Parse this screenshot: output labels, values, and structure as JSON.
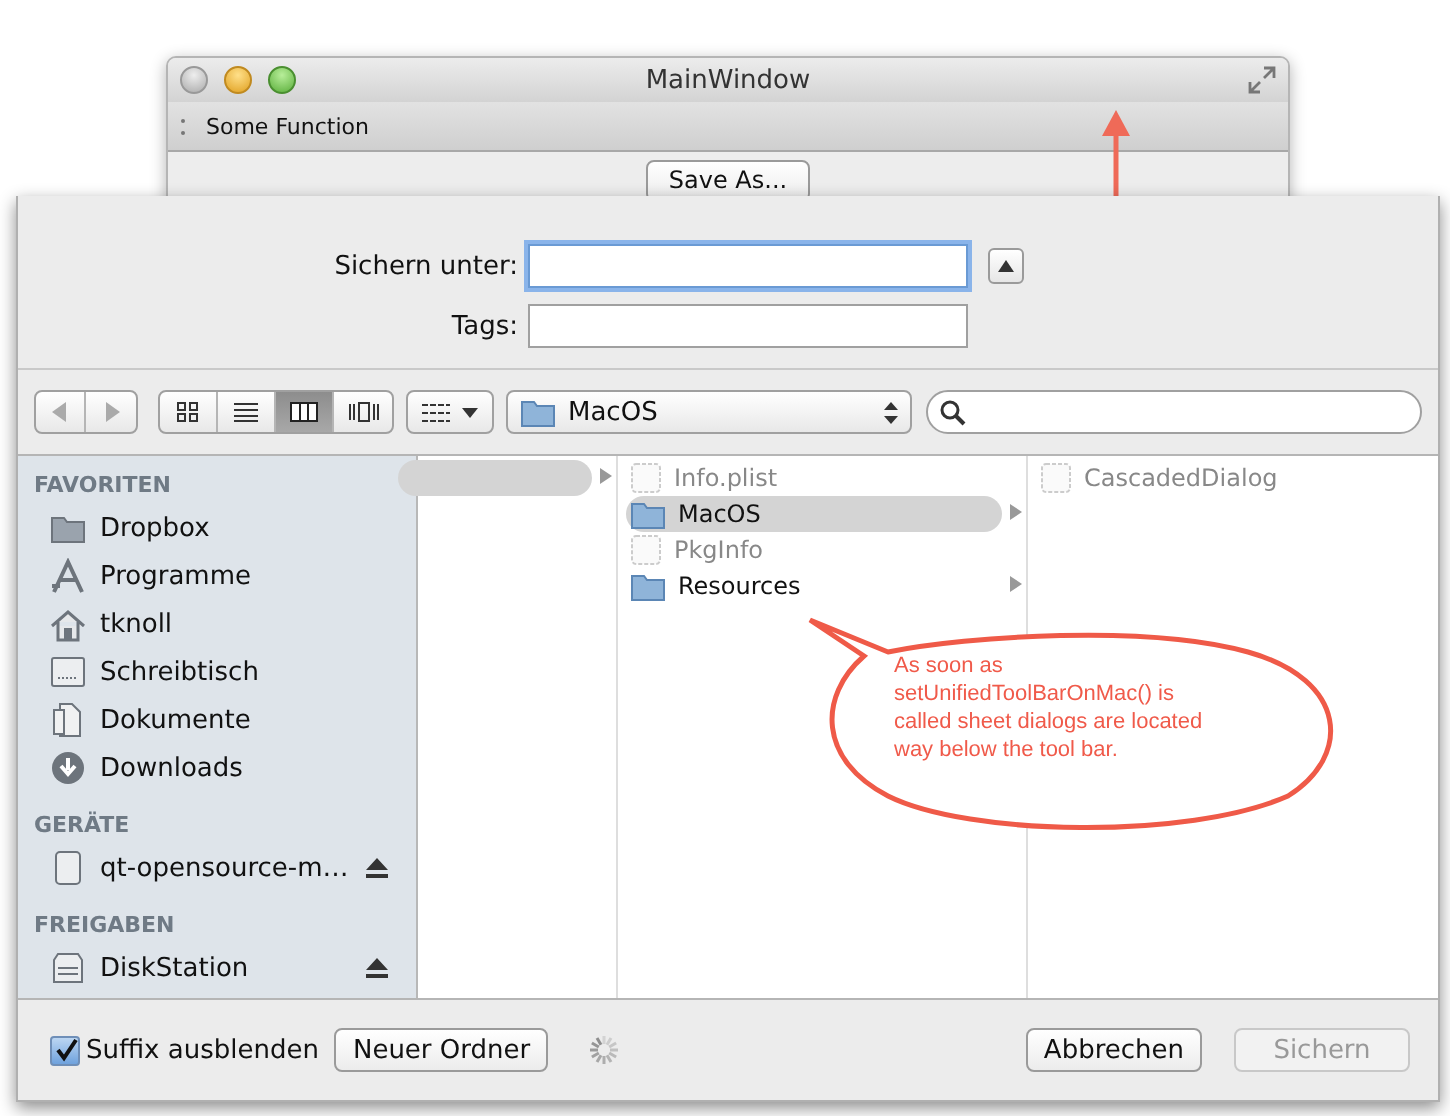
{
  "main_window": {
    "title": "MainWindow",
    "toolbar_item": "Some Function",
    "button": "Save As..."
  },
  "sheet": {
    "fields": [
      {
        "label": "Sichern unter:",
        "focused": true
      },
      {
        "label": "Tags:",
        "focused": false
      }
    ],
    "view_modes": [
      {
        "kind": "icons",
        "selected": false
      },
      {
        "kind": "list",
        "selected": false
      },
      {
        "kind": "columns",
        "selected": true
      },
      {
        "kind": "coverflow",
        "selected": false
      }
    ],
    "path": "MacOS",
    "sidebar": [
      {
        "title": "FAVORITEN",
        "items": [
          {
            "label": "Dropbox",
            "kind": "folder",
            "ejectable": false
          },
          {
            "label": "Programme",
            "kind": "apps",
            "ejectable": false
          },
          {
            "label": "tknoll",
            "kind": "home",
            "ejectable": false
          },
          {
            "label": "Schreibtisch",
            "kind": "desktop",
            "ejectable": false
          },
          {
            "label": "Dokumente",
            "kind": "documents",
            "ejectable": false
          },
          {
            "label": "Downloads",
            "kind": "downloads",
            "ejectable": false
          }
        ]
      },
      {
        "title": "GERÄTE",
        "items": [
          {
            "label": "qt-opensource-m…",
            "kind": "disk",
            "ejectable": true
          }
        ]
      },
      {
        "title": "FREIGABEN",
        "items": [
          {
            "label": "DiskStation",
            "kind": "server",
            "ejectable": true
          }
        ]
      }
    ],
    "columns": [
      {
        "items": [
          {
            "kind": "folder",
            "selected": true
          }
        ]
      },
      {
        "items": [
          {
            "label": "Info.plist",
            "kind": "file",
            "selected": false,
            "disabled": true
          },
          {
            "label": "MacOS",
            "kind": "folder",
            "selected": true,
            "disabled": false
          },
          {
            "label": "PkgInfo",
            "kind": "file",
            "selected": false,
            "disabled": true
          },
          {
            "label": "Resources",
            "kind": "folder",
            "selected": false,
            "disabled": false
          }
        ]
      },
      {
        "items": [
          {
            "label": "CascadedDialog",
            "kind": "file",
            "selected": false,
            "disabled": true
          }
        ]
      }
    ],
    "hide_suffix": {
      "label": "Suffix ausblenden",
      "checked": true
    },
    "buttons": [
      {
        "label": "Neuer Ordner",
        "disabled": false
      },
      {
        "label": "Abbrechen",
        "disabled": false
      },
      {
        "label": "Sichern",
        "disabled": true
      }
    ]
  },
  "annotation": {
    "text": "As soon as setUnifiedToolBarOnMac() is called sheet dialogs are located way below the tool bar."
  }
}
